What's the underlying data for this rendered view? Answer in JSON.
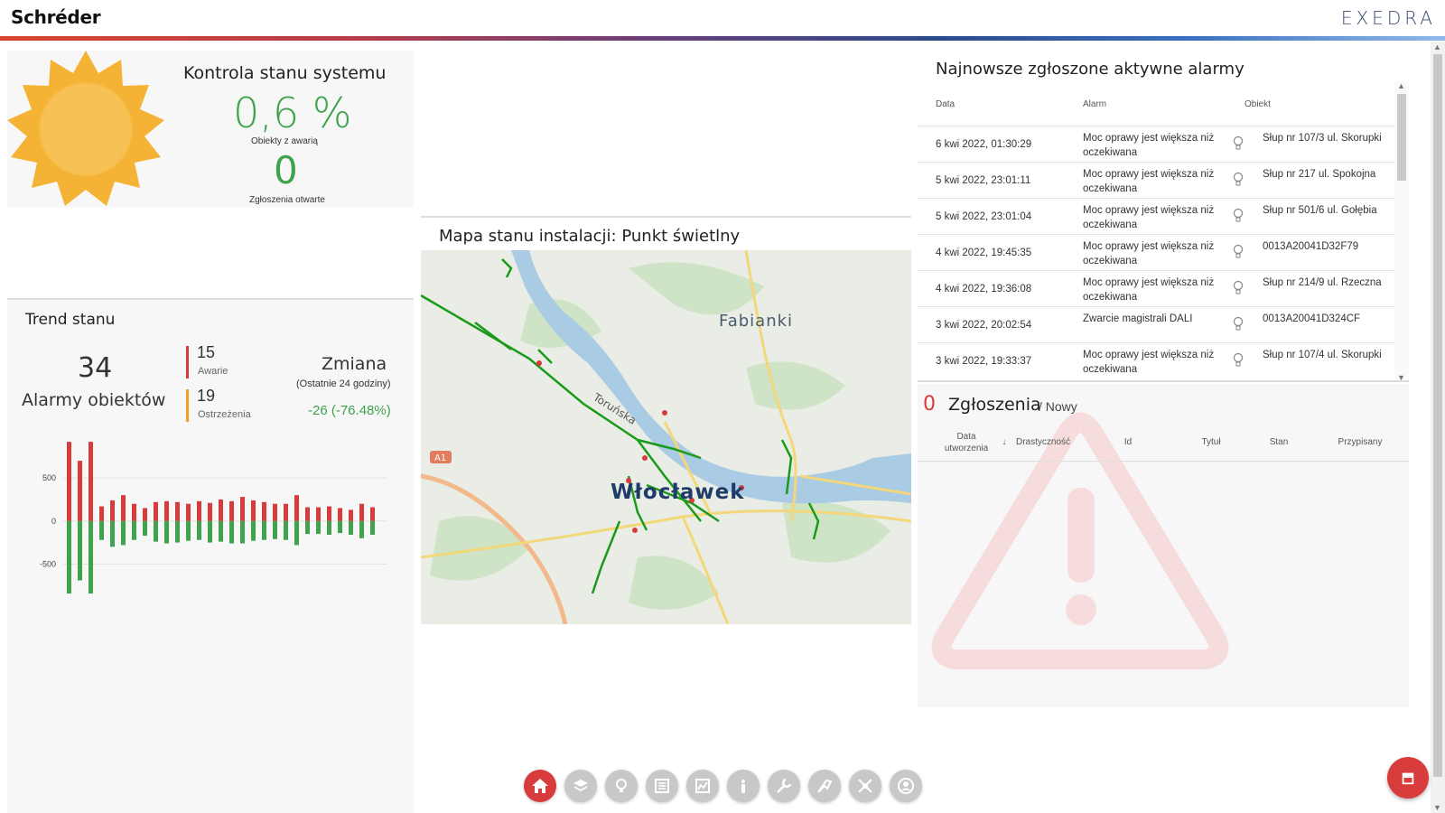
{
  "header": {
    "brand": "Schréder",
    "product": "EXEDRA"
  },
  "health": {
    "title": "Kontrola stanu systemu",
    "percent": "0,6 %",
    "percent_label": "Obiekty z awarią",
    "open_tickets": "0",
    "open_tickets_label": "Zgłoszenia otwarte"
  },
  "trend": {
    "title": "Trend stanu",
    "alarms_count": "34",
    "alarms_label": "Alarmy obiektów",
    "failures": "15",
    "failures_label": "Awarie",
    "warnings": "19",
    "warnings_label": "Ostrzeżenia",
    "change_title": "Zmiana",
    "change_sub": "(Ostatnie 24 godziny)",
    "change_value": "-26 (-76.48%)",
    "axis_ticks": [
      "500",
      "0",
      "-500"
    ],
    "colors": {
      "failures": "#d83b3b",
      "warnings": "#f09b2c",
      "positive": "#3fa34d"
    }
  },
  "chart_data": {
    "type": "bar",
    "ylim": [
      -800,
      900
    ],
    "yticks": [
      500,
      0,
      -500
    ],
    "grid": true,
    "series": [
      {
        "values": [
          920,
          700,
          920,
          170,
          240,
          300,
          200,
          150,
          220,
          230,
          220,
          200,
          230,
          210,
          250,
          230,
          280,
          240,
          220,
          200,
          200,
          300,
          160,
          160,
          170,
          150,
          130,
          200,
          160
        ]
      },
      {
        "values": [
          -920,
          -690,
          -920,
          -220,
          -300,
          -280,
          -220,
          -170,
          -240,
          -260,
          -250,
          -230,
          -220,
          -250,
          -240,
          -260,
          -260,
          -230,
          -220,
          -210,
          -220,
          -280,
          -150,
          -150,
          -160,
          -140,
          -160,
          -200,
          -160
        ]
      }
    ]
  },
  "map": {
    "title": "Mapa stanu instalacji: Punkt świetlny",
    "labels": {
      "city": "Włocławek",
      "village": "Fabianki",
      "street": "Toruńska",
      "road": "A1"
    }
  },
  "alarms": {
    "title": "Najnowsze zgłoszone aktywne alarmy",
    "columns": {
      "date": "Data",
      "alarm": "Alarm",
      "object": "Obiekt"
    },
    "rows": [
      {
        "date": "6 kwi 2022, 01:30:29",
        "alarm": "Moc oprawy jest większa niż oczekiwana",
        "object": "Słup nr 107/3 ul. Skorupki"
      },
      {
        "date": "5 kwi 2022, 23:01:11",
        "alarm": "Moc oprawy jest większa niż oczekiwana",
        "object": "Słup nr 217 ul. Spokojna"
      },
      {
        "date": "5 kwi 2022, 23:01:04",
        "alarm": "Moc oprawy jest większa niż oczekiwana",
        "object": "Słup nr 501/6 ul. Gołębia"
      },
      {
        "date": "4 kwi 2022, 19:45:35",
        "alarm": "Moc oprawy jest większa niż oczekiwana",
        "object": "0013A20041D32F79"
      },
      {
        "date": "4 kwi 2022, 19:36:08",
        "alarm": "Moc oprawy jest większa niż oczekiwana",
        "object": "Słup nr 214/9 ul. Rzeczna"
      },
      {
        "date": "3 kwi 2022, 20:02:54",
        "alarm": "Zwarcie magistrali DALI",
        "object": "0013A20041D324CF"
      },
      {
        "date": "3 kwi 2022, 19:33:37",
        "alarm": "Moc oprawy jest większa niż oczekiwana",
        "object": "Słup nr 107/4 ul. Skorupki"
      }
    ]
  },
  "tickets": {
    "count": "0",
    "title": "Zgłoszenia",
    "subtitle": "/ Nowy",
    "columns": {
      "created": "Data utworzenia",
      "severity": "Drastyczność",
      "id": "Id",
      "subject": "Tytuł",
      "state": "Stan",
      "assigned": "Przypisany"
    }
  },
  "nav": {
    "icons": [
      "home-icon",
      "layers-icon",
      "lightbulb-icon",
      "catalog-icon",
      "analytics-icon",
      "info-icon",
      "wrench-icon",
      "tools-icon",
      "drone-icon",
      "user-icon"
    ],
    "active_color": "#d83b3b",
    "inactive_color": "#c8c8c8"
  }
}
